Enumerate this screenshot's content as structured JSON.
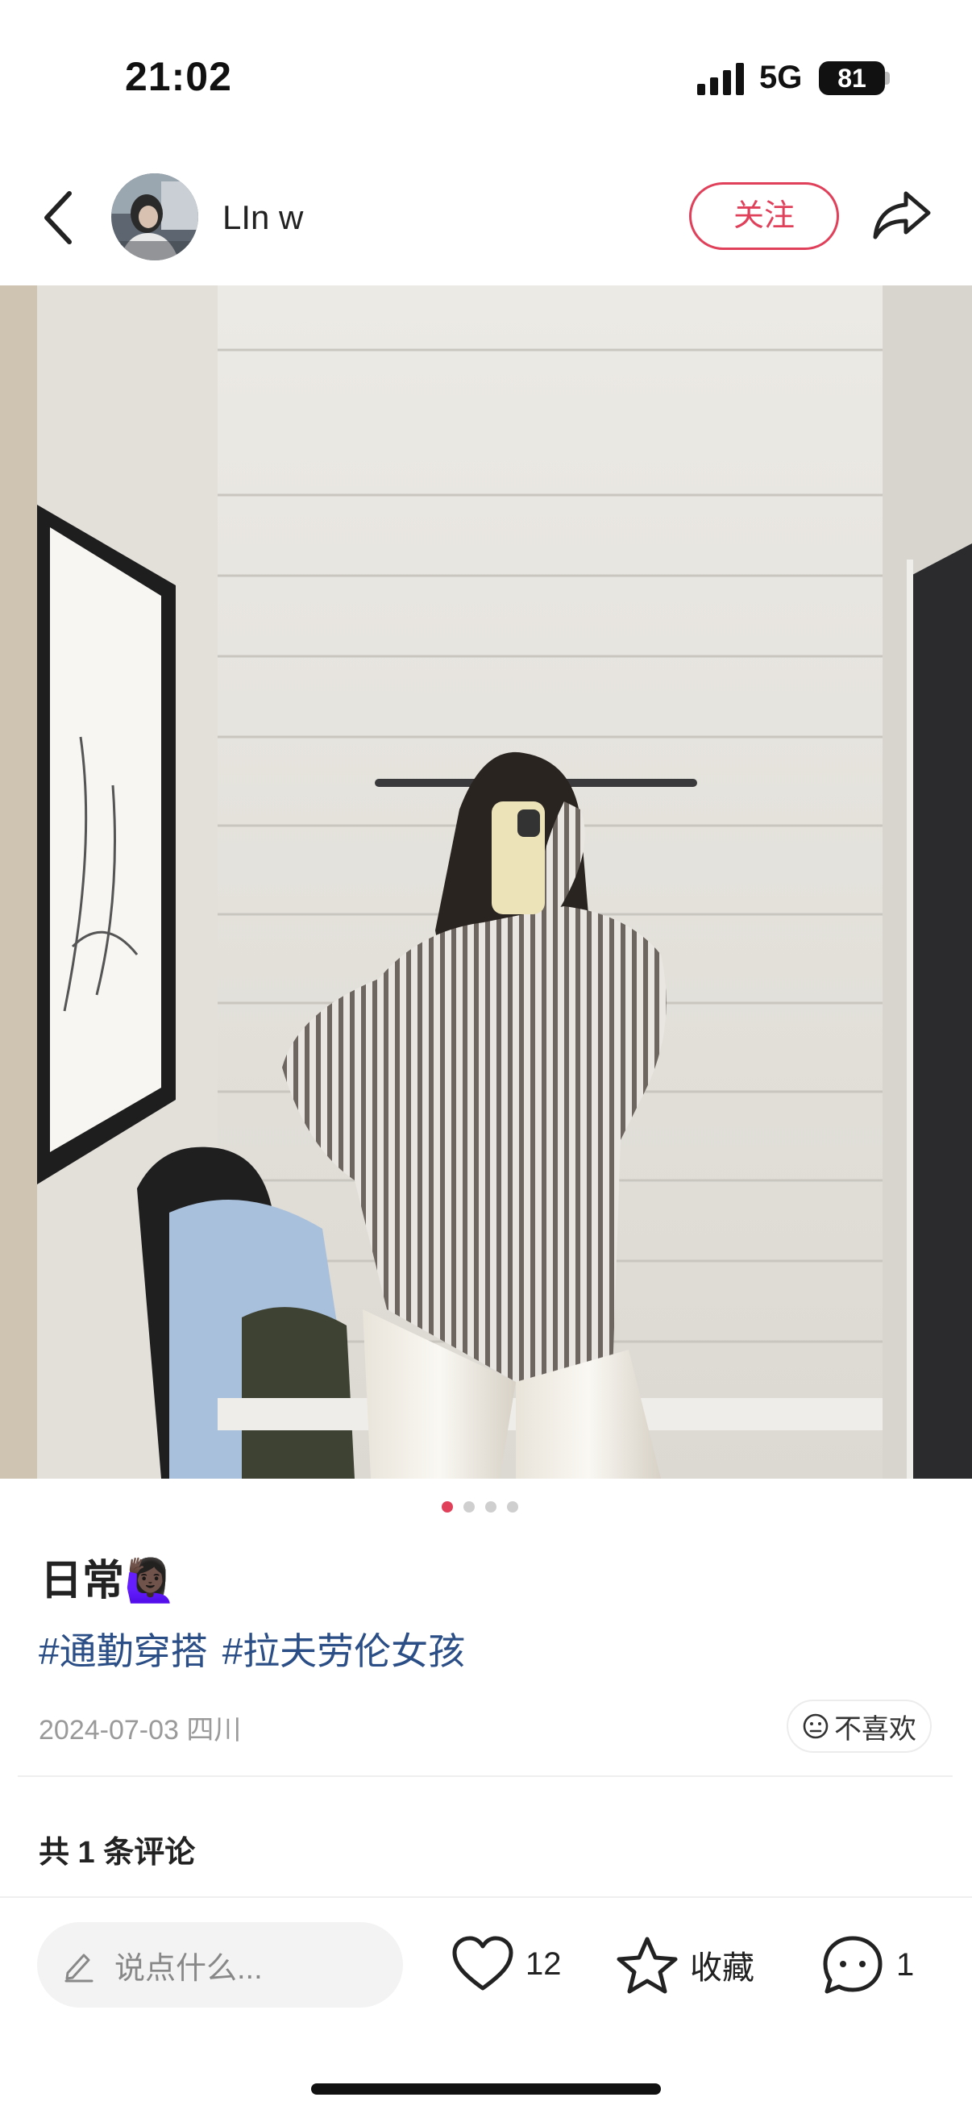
{
  "status_bar": {
    "time": "21:02",
    "network": "5G",
    "battery": "81"
  },
  "header": {
    "author_name": "LIn w",
    "follow_label": "关注"
  },
  "carousel": {
    "count": 4,
    "active_index": 0
  },
  "post": {
    "title": "日常🙋🏿‍♀️",
    "tags": [
      "#通勤穿搭",
      "#拉夫劳伦女孩"
    ],
    "meta": "2024-07-03 四川",
    "dislike_label": "不喜欢"
  },
  "comments": {
    "count_label": "共 1 条评论"
  },
  "bottom_bar": {
    "input_placeholder": "说点什么...",
    "likes": "12",
    "collect_label": "收藏",
    "comments": "1"
  },
  "colors": {
    "accent": "#e0405a",
    "tag": "#2b4e86",
    "meta": "#9a9a9a"
  }
}
